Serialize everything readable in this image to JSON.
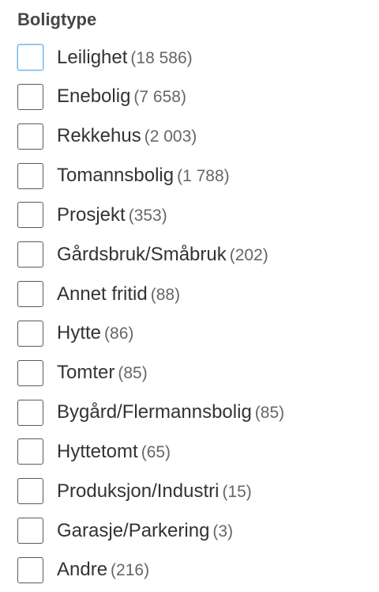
{
  "filter": {
    "heading": "Boligtype",
    "options": [
      {
        "label": "Leilighet",
        "count": "(18 586)",
        "checked": false,
        "focused": true
      },
      {
        "label": "Enebolig",
        "count": "(7 658)",
        "checked": false
      },
      {
        "label": "Rekkehus",
        "count": "(2 003)",
        "checked": false
      },
      {
        "label": "Tomannsbolig",
        "count": "(1 788)",
        "checked": false
      },
      {
        "label": "Prosjekt",
        "count": "(353)",
        "checked": false
      },
      {
        "label": "Gårdsbruk/Småbruk",
        "count": "(202)",
        "checked": false
      },
      {
        "label": "Annet fritid",
        "count": "(88)",
        "checked": false
      },
      {
        "label": "Hytte",
        "count": "(86)",
        "checked": false
      },
      {
        "label": "Tomter",
        "count": "(85)",
        "checked": false
      },
      {
        "label": "Bygård/Flermannsbolig",
        "count": "(85)",
        "checked": false
      },
      {
        "label": "Hyttetomt",
        "count": "(65)",
        "checked": false
      },
      {
        "label": "Produksjon/Industri",
        "count": "(15)",
        "checked": false
      },
      {
        "label": "Garasje/Parkering",
        "count": "(3)",
        "checked": false
      },
      {
        "label": "Andre",
        "count": "(216)",
        "checked": false
      }
    ]
  }
}
